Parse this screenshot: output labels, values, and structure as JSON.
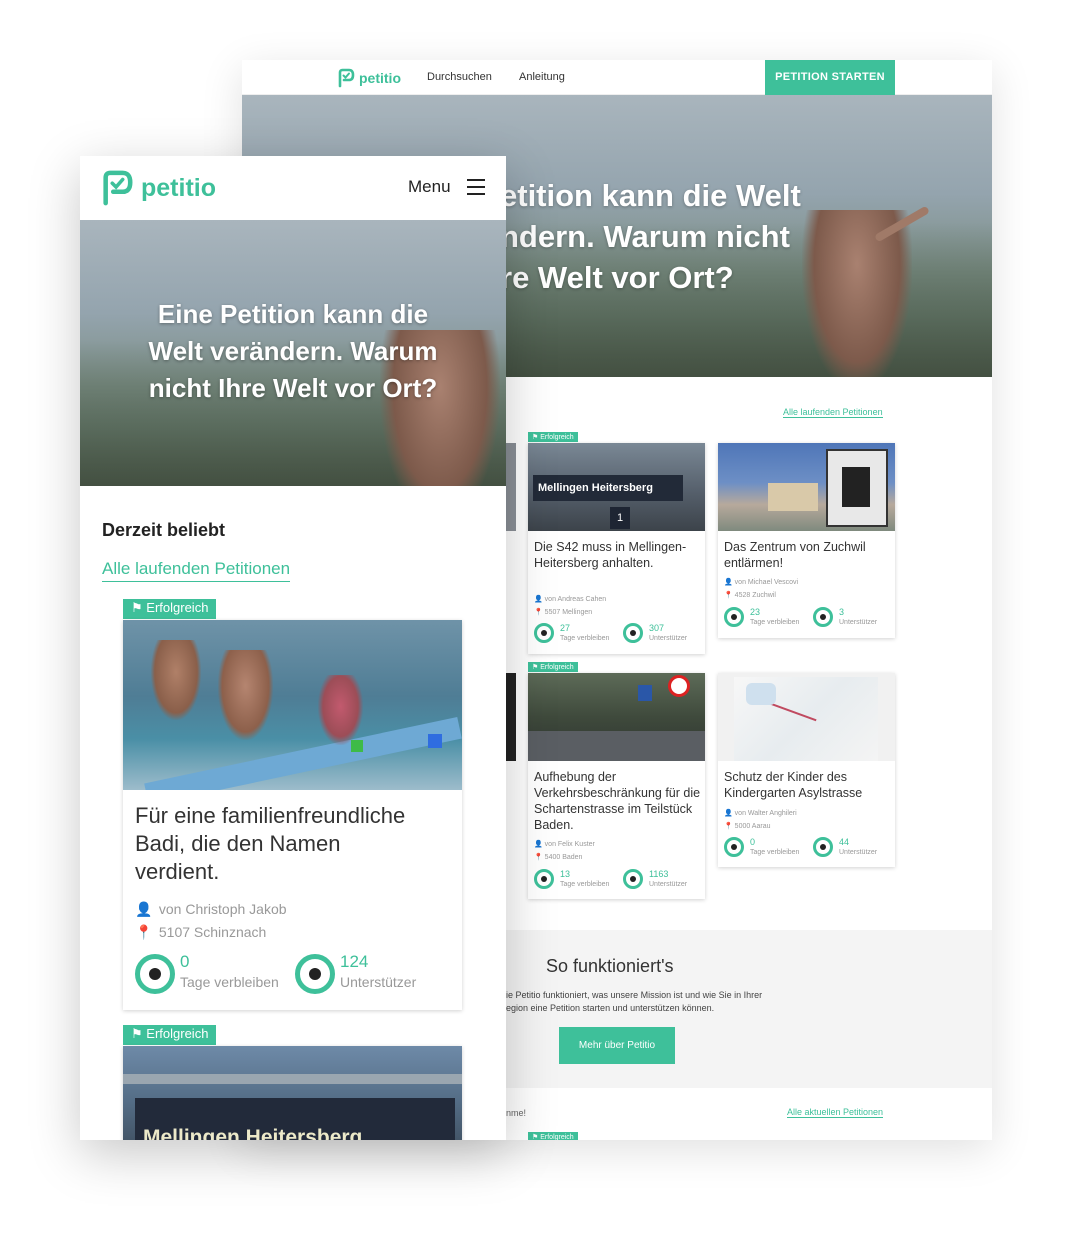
{
  "desktop": {
    "nav": {
      "logo": "petitio",
      "links": [
        "Durchsuchen",
        "Anleitung"
      ],
      "cta": "PETITION STARTEN"
    },
    "hero_lines": [
      "etition kann die Welt",
      "ndern. Warum nicht",
      "re Welt vor Ort?"
    ],
    "all_running_link": "Alle laufenden Petitionen",
    "flag_label": "Erfolgreich",
    "cards": [
      {
        "title": "Die S42 muss in Mellingen-Heitersberg anhalten.",
        "author": "von Andreas Cahen",
        "place": "5507 Mellingen",
        "days": "27",
        "days_label": "Tage verbleiben",
        "supporters": "307",
        "supporters_label": "Unterstützer",
        "sign_text": "Mellingen Heitersberg"
      },
      {
        "title": "Das Zentrum von Zuchwil entlärmen!",
        "author": "von Michael Vescovi",
        "place": "4528 Zuchwil",
        "days": "23",
        "days_label": "Tage verbleiben",
        "supporters": "3",
        "supporters_label": "Unterstützer"
      },
      {
        "title": "Aufhebung der Verkehrsbeschränkung für die Schartenstrasse im Teilstück Baden.",
        "author": "von Felix Kuster",
        "place": "5400 Baden",
        "days": "13",
        "days_label": "Tage verbleiben",
        "supporters": "1163",
        "supporters_label": "Unterstützer"
      },
      {
        "title": "Schutz der Kinder des Kindergarten Asylstrasse",
        "author": "von Walter Anghileri",
        "place": "5000 Aarau",
        "days": "0",
        "days_label": "Tage verbleiben",
        "supporters": "44",
        "supporters_label": "Unterstützer"
      }
    ],
    "how": {
      "title": "So funktioniert's",
      "text_lines": [
        "ie Petitio funktioniert, was unsere Mission ist und wie Sie in Ihrer",
        "egion eine Petition starten und unterstützen können."
      ],
      "button": "Mehr über Petitio"
    },
    "footer_left": "nme!",
    "footer_link": "Alle aktuellen Petitionen"
  },
  "mobile": {
    "logo": "petitio",
    "menu": "Menu",
    "hero_lines": [
      "Eine Petition kann die",
      "Welt verändern. Warum",
      "nicht Ihre Welt vor Ort?"
    ],
    "section_title": "Derzeit beliebt",
    "all_link": "Alle laufenden Petitionen",
    "flag_label": "Erfolgreich",
    "card": {
      "title_lines": [
        "Für eine familienfreundliche",
        "Badi, die den Namen",
        "verdient."
      ],
      "author": "von Christoph Jakob",
      "place": "5107 Schinznach",
      "days": "0",
      "days_label": "Tage verbleiben",
      "supporters": "124",
      "supporters_label": "Unterstützer"
    },
    "card2_sign": "Mellingen Heitersberg"
  },
  "colors": {
    "accent": "#3ec09a",
    "text": "#333333",
    "muted": "#999999"
  }
}
